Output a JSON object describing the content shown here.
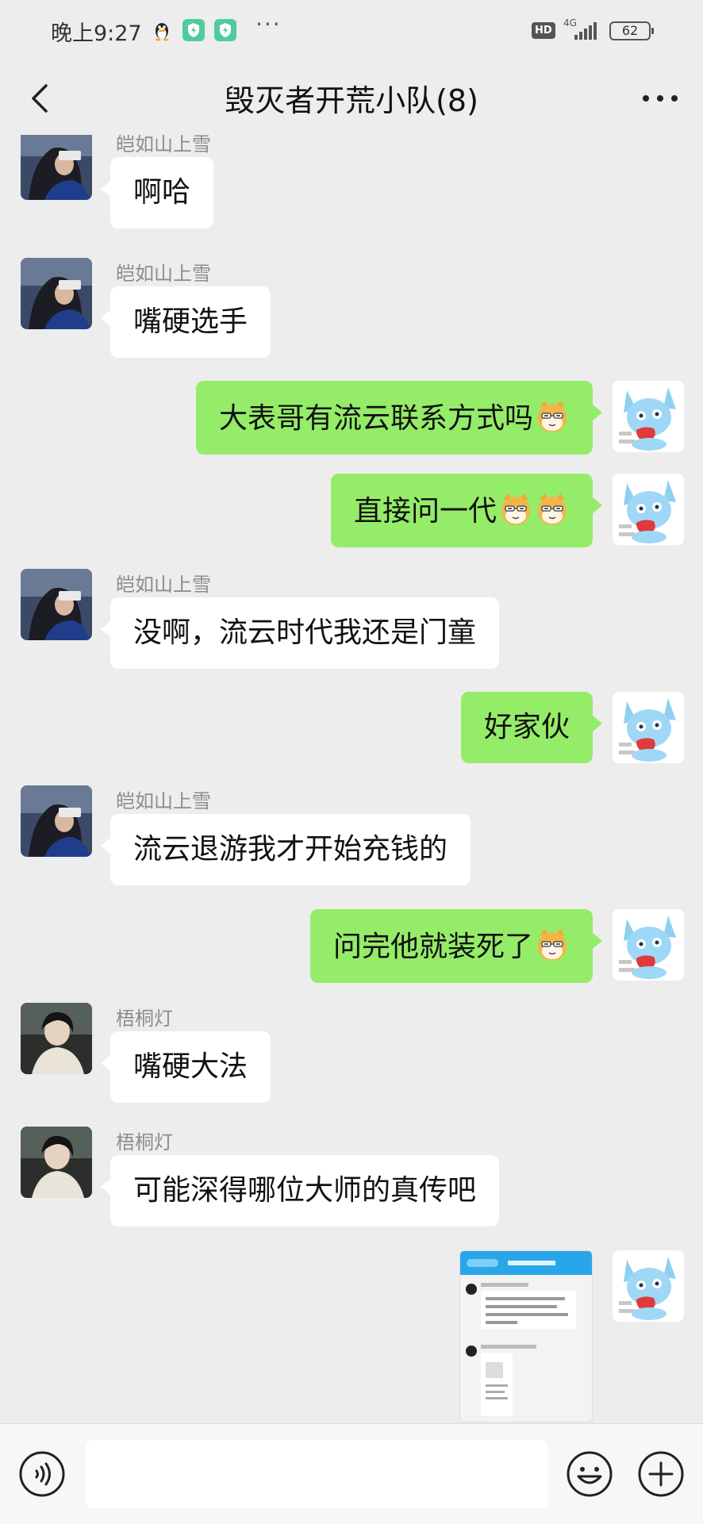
{
  "status_bar": {
    "time": "晚上9:27",
    "hd": "HD",
    "network": "4G",
    "battery": "62"
  },
  "header": {
    "title": "毁灭者开荒小队(8)"
  },
  "messages": [
    {
      "side": "left",
      "sender": "皑如山上雪",
      "text": "啊哈"
    },
    {
      "side": "left",
      "sender": "皑如山上雪",
      "text": "嘴硬选手"
    },
    {
      "side": "right",
      "text": "大表哥有流云联系方式吗",
      "emoji_count": 1
    },
    {
      "side": "right",
      "text": "直接问一代",
      "emoji_count": 2
    },
    {
      "side": "left",
      "sender": "皑如山上雪",
      "text": "没啊，流云时代我还是门童"
    },
    {
      "side": "right",
      "text": "好家伙"
    },
    {
      "side": "left",
      "sender": "皑如山上雪",
      "text": "流云退游我才开始充钱的"
    },
    {
      "side": "right",
      "text": "问完他就装死了",
      "emoji_count": 1
    },
    {
      "side": "left",
      "sender": "梧桐灯",
      "text": "嘴硬大法"
    },
    {
      "side": "left",
      "sender": "梧桐灯",
      "text": "可能深得哪位大师的真传吧"
    },
    {
      "side": "right",
      "type": "image",
      "image_desc": "chat-screenshot-thumbnail"
    }
  ],
  "input": {
    "placeholder": ""
  },
  "icons": {
    "back": "back-arrow-icon",
    "more": "more-dots-icon",
    "voice": "voice-icon",
    "emoji": "emoji-icon",
    "plus": "plus-icon",
    "emoji_sticker": "shiba-face-emoji"
  },
  "colors": {
    "background": "#ededed",
    "self_bubble": "#95ec69",
    "other_bubble": "#ffffff",
    "sender_name": "#8c8c8c"
  }
}
